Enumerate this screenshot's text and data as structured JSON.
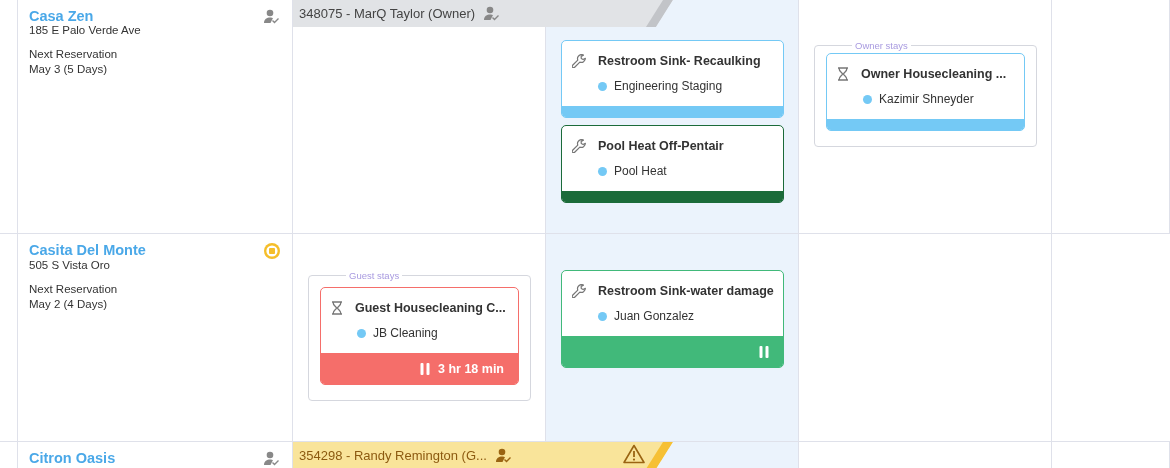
{
  "day_columns": [
    {
      "highlighted": false
    },
    {
      "highlighted": true
    },
    {
      "highlighted": false
    },
    {
      "highlighted": false
    }
  ],
  "properties": [
    {
      "name": "Casa Zen",
      "address": "185 E Palo Verde Ave",
      "next_label": "Next Reservation",
      "next_date": "May 3 (5 Days)",
      "on_hold": false,
      "reservation": {
        "kind": "owner",
        "label": "348075 - MarQ Taylor (Owner)",
        "warning": false
      },
      "day_2": [
        {
          "kind": "maintenance",
          "title": "Restroom Sink- Recaulking",
          "assignee": "Engineering Staging",
          "color": "#74c9f5",
          "paused": false
        },
        {
          "kind": "maintenance",
          "title": "Pool Heat Off-Pentair",
          "assignee": "Pool Heat",
          "color": "#1b6b3a",
          "paused": false
        }
      ],
      "day_3": [
        {
          "kind": "group",
          "label": "Owner stays",
          "tasks": [
            {
              "kind": "cleaning",
              "title": "Owner Housecleaning ...",
              "assignee": "Kazimir Shneyder",
              "color": "#74c9f5",
              "paused": false
            }
          ]
        }
      ]
    },
    {
      "name": "Casita Del Monte",
      "address": "505 S Vista Oro",
      "next_label": "Next Reservation",
      "next_date": "May 2 (4 Days)",
      "on_hold": true,
      "day_1": [
        {
          "kind": "group",
          "label": "Guest stays",
          "tasks": [
            {
              "kind": "cleaning",
              "title": "Guest Housecleaning C...",
              "assignee": "JB Cleaning",
              "color": "#f56e6a",
              "paused": true,
              "timer": "3 hr 18 min"
            }
          ]
        }
      ],
      "day_2": [
        {
          "kind": "maintenance",
          "title": "Restroom Sink-water damage",
          "assignee": "Juan Gonzalez",
          "color": "#41b97a",
          "paused": true
        }
      ]
    },
    {
      "name": "Citron Oasis",
      "on_hold": false,
      "reservation": {
        "kind": "guest",
        "label": "354298 - Randy Remington (G...",
        "warning": true
      }
    }
  ]
}
